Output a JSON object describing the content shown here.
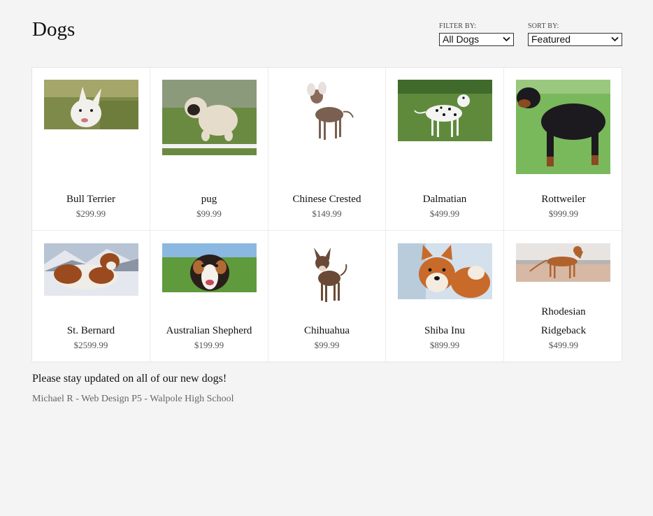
{
  "header": {
    "title": "Dogs"
  },
  "filter": {
    "label": "FILTER BY:",
    "selected": "All Dogs"
  },
  "sort": {
    "label": "SORT BY:",
    "selected": "Featured"
  },
  "products": [
    {
      "name": "Bull Terrier",
      "price": "$299.99",
      "image": "bull-terrier-photo"
    },
    {
      "name": "pug",
      "price": "$99.99",
      "image": "pug-photo"
    },
    {
      "name": "Chinese Crested",
      "price": "$149.99",
      "image": "chinese-crested-photo"
    },
    {
      "name": "Dalmatian",
      "price": "$499.99",
      "image": "dalmatian-photo"
    },
    {
      "name": "Rottweiler",
      "price": "$999.99",
      "image": "rottweiler-photo"
    },
    {
      "name": "St. Bernard",
      "price": "$2599.99",
      "image": "st-bernard-photo"
    },
    {
      "name": "Australian Shepherd",
      "price": "$199.99",
      "image": "australian-shepherd-photo"
    },
    {
      "name": "Chihuahua",
      "price": "$99.99",
      "image": "chihuahua-photo"
    },
    {
      "name": "Shiba Inu",
      "price": "$899.99",
      "image": "shiba-inu-photo"
    },
    {
      "name": "Rhodesian Ridgeback",
      "price": "$499.99",
      "image": "rhodesian-ridgeback-photo"
    }
  ],
  "footer": {
    "message": "Please stay updated on all of our new dogs!",
    "credit": "Michael R - Web Design P5 - Walpole High School"
  }
}
